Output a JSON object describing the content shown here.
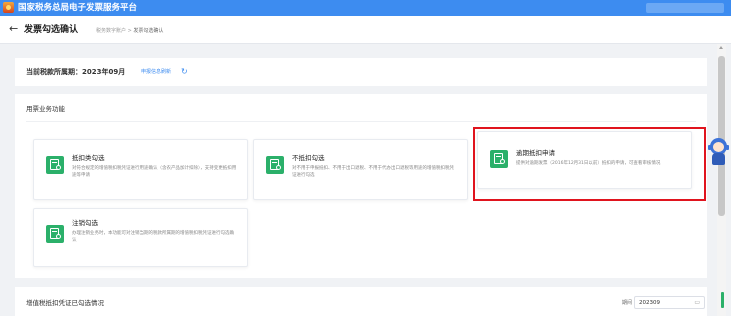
{
  "app": {
    "title": "国家税务总局电子发票服务平台"
  },
  "header": {
    "back_icon": "←",
    "title": "发票勾选确认",
    "breadcrumb": {
      "parent": "税务数字账户",
      "separator": ">",
      "current": "发票勾选确认"
    }
  },
  "period": {
    "label": "当前税款所属期：2023年09月",
    "link": "申报信息刷新",
    "refresh_icon": "↻"
  },
  "functions": {
    "title": "用票业务功能",
    "cards": [
      {
        "title": "抵扣类勾选",
        "desc": "对符合规定的增值税扣税凭证进行用途确认（含农产品加计扣除），支持变更抵扣用途等申请"
      },
      {
        "title": "不抵扣勾选",
        "desc": "对不用于申报抵扣、不用于出口退税、不用于代办出口退税等用途的增值税扣税凭证进行勾选"
      },
      {
        "title": "逾期抵扣申请",
        "desc": "提供对逾期发票（2016年12月31日以前）抵扣的申请，可查看审核情况"
      },
      {
        "title": "注销勾选",
        "desc": "办理注销业务时，本功能可对注销当期的税款所属期的增值税扣税凭证进行勾选确认"
      }
    ]
  },
  "summary": {
    "title": "增值税抵扣凭证已勾选情况",
    "period_label": "期间",
    "period_value": "202309",
    "calendar_icon": "▭"
  },
  "colors": {
    "primary": "#3d8cf0",
    "icon_green": "#2bb06a",
    "highlight_red": "#e0141e"
  }
}
